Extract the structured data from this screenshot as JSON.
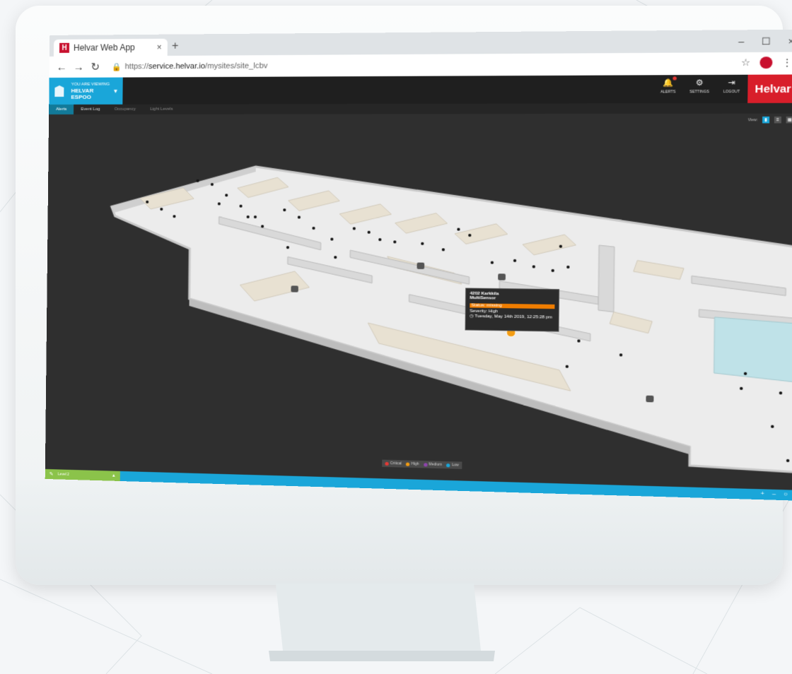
{
  "browser": {
    "tab_title": "Helvar Web App",
    "tab_logo": "H",
    "tab_close": "×",
    "new_tab": "+",
    "window_controls": [
      "–",
      "☐",
      "×"
    ],
    "url_prefix": "https://",
    "url_host": "service.helvar.io",
    "url_path": "/mysites/site_lcbv"
  },
  "header": {
    "viewing_label": "YOU ARE VIEWING",
    "site_name": "HELVAR ESPOO",
    "actions": [
      {
        "label": "ALERTS",
        "icon": "bell-icon"
      },
      {
        "label": "SETTINGS",
        "icon": "gear-icon"
      },
      {
        "label": "LOGOUT",
        "icon": "logout-icon"
      }
    ],
    "brand": "Helvar"
  },
  "subnav": {
    "tabs": [
      "Alerts",
      "Event Log",
      "Occupancy",
      "Light Levels"
    ],
    "active": "Alerts"
  },
  "view": {
    "label": "View:"
  },
  "tooltip": {
    "title": "4202 Karkkila",
    "subtitle": "MultiSensor",
    "status": "Status: missing",
    "severity": "Severity: High",
    "timestamp": "Tuesday, May 14th 2019, 12:25:28 pm"
  },
  "legend": {
    "items": [
      {
        "label": "Critical",
        "color": "#e53935"
      },
      {
        "label": "High",
        "color": "#f39c12"
      },
      {
        "label": "Medium",
        "color": "#8e44ad"
      },
      {
        "label": "Low",
        "color": "#1aa6d9"
      }
    ]
  },
  "footer": {
    "level": "Level 2",
    "zoom_in": "+",
    "zoom_out": "–",
    "reset": "○"
  },
  "colors": {
    "accent": "#1aa6d9",
    "brand_red": "#d81e2a",
    "status_orange": "#f07d00",
    "level_green": "#8bc34a"
  }
}
